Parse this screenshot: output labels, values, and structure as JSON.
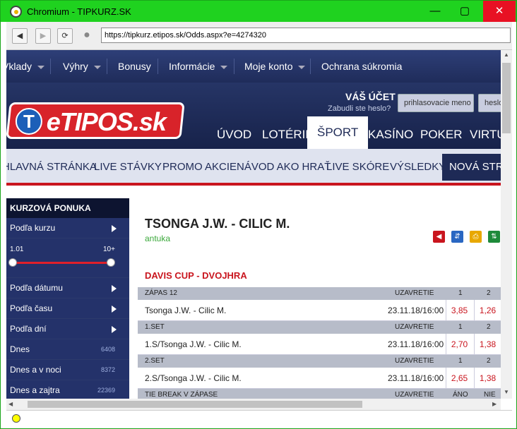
{
  "window": {
    "title": "Chromium - TIPKURZ.SK"
  },
  "address_bar": {
    "url": "https://tipkurz.etipos.sk/Odds.aspx?e=4274320"
  },
  "top_nav": {
    "items": [
      "Vklady",
      "Výhry",
      "Bonusy",
      "Informácie",
      "Moje konto",
      "Ochrana súkromia"
    ]
  },
  "header": {
    "logo_text": "eTIPOS.sk",
    "logo_letter": "T",
    "account_title": "VÁŠ ÚČET",
    "forgot_password": "Zabudli ste heslo?",
    "username_placeholder": "prihlasovacie meno",
    "password_placeholder": "heslo"
  },
  "main_nav": {
    "items": [
      "ÚVOD",
      "LOTÉRIE",
      "ŠPORT",
      "KASÍNO",
      "POKER",
      "VIRTUAL"
    ],
    "active": "ŠPORT"
  },
  "sub_nav": {
    "items": [
      "HLAVNÁ STRÁNKA",
      "LIVE STÁVKY",
      "PROMO AKCIE",
      "NÁVOD AKO HRAŤ",
      "LIVE SKÓRE",
      "VÝSLEDKY",
      "NOVÁ STRÁNKA"
    ]
  },
  "sidebar": {
    "heading": "KURZOVÁ PONUKA",
    "by_odds": "Podľa kurzu",
    "range_min": "1.01",
    "range_max": "10+",
    "items": [
      {
        "label": "Podľa dátumu"
      },
      {
        "label": "Podľa času"
      },
      {
        "label": "Podľa dní"
      }
    ],
    "counts": [
      {
        "label": "Dnes",
        "count": "6408"
      },
      {
        "label": "Dnes a v noci",
        "count": "8372"
      },
      {
        "label": "Dnes a zajtra",
        "count": "22369"
      }
    ]
  },
  "event": {
    "title": "TSONGA J.W. - CILIC M.",
    "surface": "antuka",
    "competition": "DAVIS CUP - DVOJHRA"
  },
  "markets": [
    {
      "header": "ZÁPAS 12",
      "col": "UZAVRETIE",
      "o1": "1",
      "o2": "2",
      "name": "Tsonga J.W. - Cilic M.",
      "close": "23.11.18/16:00",
      "v1": "3,85",
      "v2": "1,26"
    },
    {
      "header": "1.SET",
      "col": "UZAVRETIE",
      "o1": "1",
      "o2": "2",
      "name": "1.S/Tsonga J.W. - Cilic M.",
      "close": "23.11.18/16:00",
      "v1": "2,70",
      "v2": "1,38"
    },
    {
      "header": "2.SET",
      "col": "UZAVRETIE",
      "o1": "1",
      "o2": "2",
      "name": "2.S/Tsonga J.W. - Cilic M.",
      "close": "23.11.18/16:00",
      "v1": "2,65",
      "v2": "1,38"
    },
    {
      "header": "TIE BREAK V ZÁPASE",
      "col": "UZAVRETIE",
      "o1": "ÁNO",
      "o2": "NIE"
    }
  ],
  "colors": {
    "navy": "#1e2a56",
    "red": "#c9151e",
    "titlebar": "#1fd21f"
  }
}
